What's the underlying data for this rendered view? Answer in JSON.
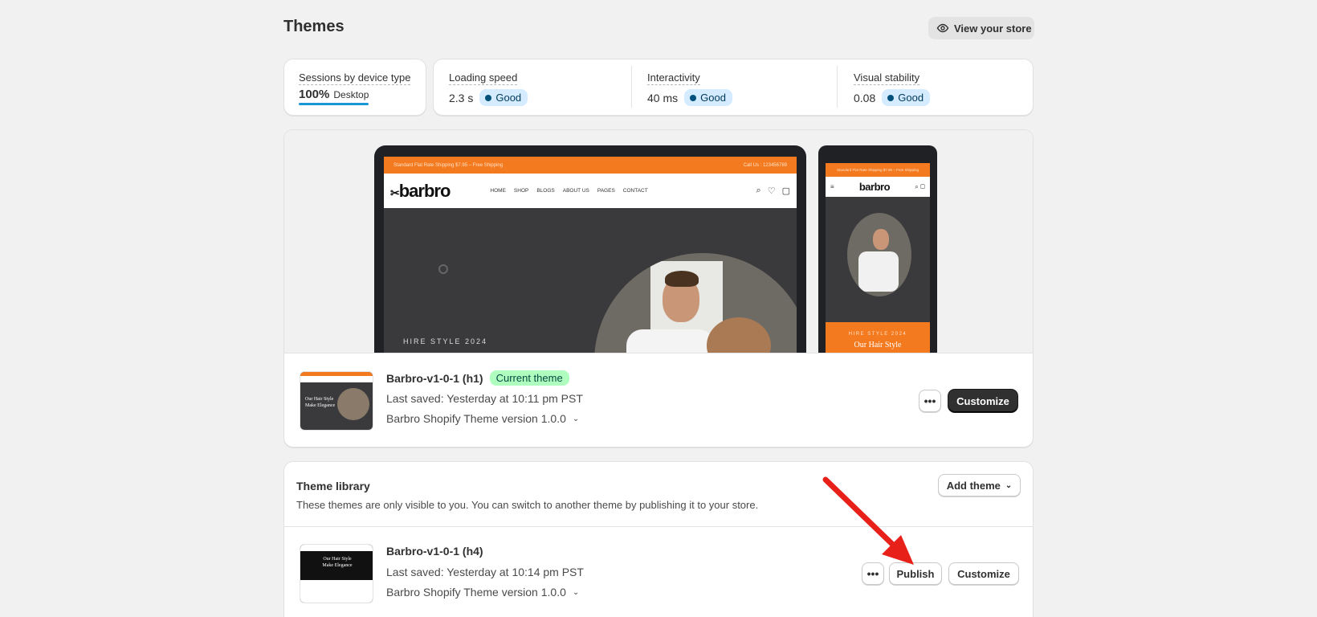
{
  "page": {
    "title": "Themes",
    "view_store_label": "View your store"
  },
  "sessions": {
    "label": "Sessions by device type",
    "percent": "100%",
    "device": "Desktop"
  },
  "metrics": [
    {
      "label": "Loading speed",
      "value": "2.3 s",
      "status": "Good"
    },
    {
      "label": "Interactivity",
      "value": "40 ms",
      "status": "Good"
    },
    {
      "label": "Visual stability",
      "value": "0.08",
      "status": "Good"
    }
  ],
  "preview": {
    "desktop_topbar_left": "Standard Flat Rate Shipping $7.95 – Free Shipping",
    "desktop_topbar_right": "Call Us : 123456789",
    "logo": "barbro",
    "nav": [
      "HOME",
      "SHOP",
      "BLOGS",
      "ABOUT US",
      "PAGES",
      "CONTACT"
    ],
    "hero_text": "HIRE STYLE 2024",
    "mobile_topbar": "Standard Flat Rate Shipping $7.95 – Free Shipping",
    "mobile_hero_kicker": "HIRE STYLE 2024",
    "mobile_hero_title": "Our Hair Style"
  },
  "current_theme": {
    "name": "Barbro-v1-0-1 (h1)",
    "badge": "Current theme",
    "last_saved": "Last saved: Yesterday at 10:11 pm PST",
    "version": "Barbro Shopify Theme version 1.0.0",
    "customize_label": "Customize",
    "thumb_text": "Our Hair Style Make Elegance"
  },
  "library": {
    "title": "Theme library",
    "description": "These themes are only visible to you. You can switch to another theme by publishing it to your store.",
    "add_theme_label": "Add theme",
    "themes": [
      {
        "name": "Barbro-v1-0-1 (h4)",
        "last_saved": "Last saved: Yesterday at 10:14 pm PST",
        "version": "Barbro Shopify Theme version 1.0.0",
        "publish_label": "Publish",
        "customize_label": "Customize",
        "thumb_text": "Our Hair Style Make Elegance"
      }
    ]
  },
  "colors": {
    "accent_orange": "#f47a20",
    "primary_button": "#303030",
    "annotation_arrow": "#e8201a"
  }
}
